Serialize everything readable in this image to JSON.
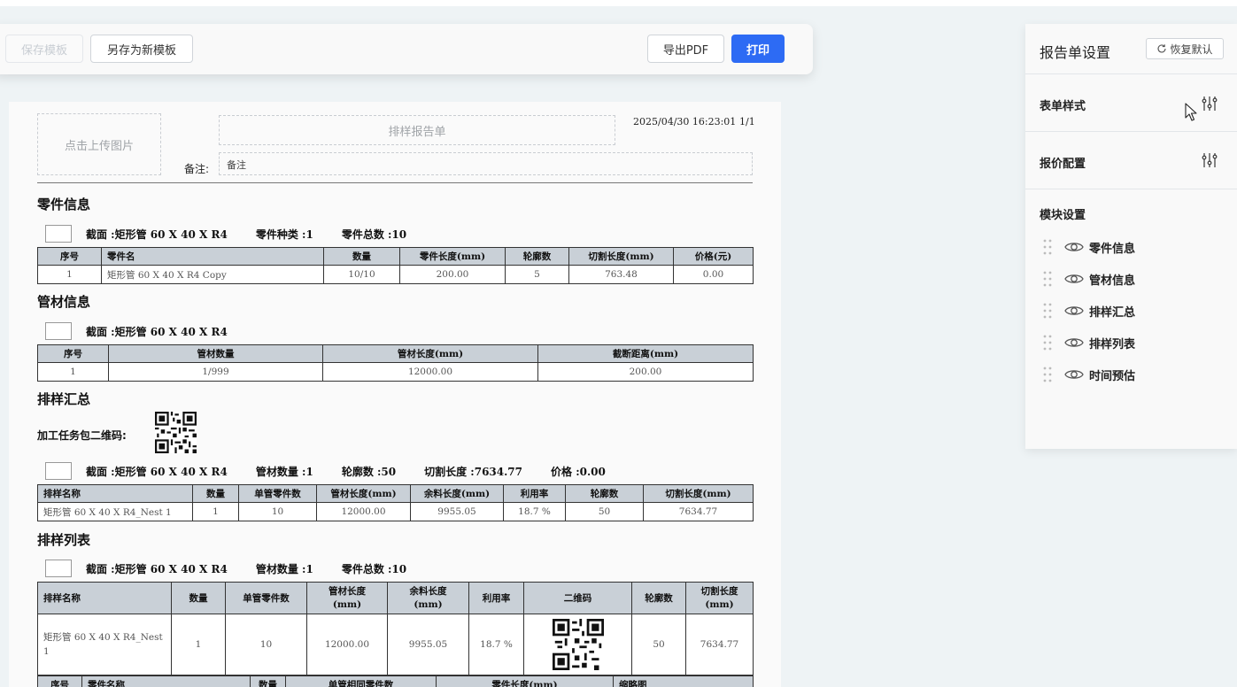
{
  "toolbar": {
    "save_template": "保存模板",
    "save_as_new": "另存为新模板",
    "export_pdf": "导出PDF",
    "print": "打印"
  },
  "header": {
    "upload_placeholder": "点击上传图片",
    "title_placeholder": "排样报告单",
    "datetime": "2025/04/30 16:23:01",
    "page": "1/1",
    "remark_label": "备注:",
    "remark_value": "备注"
  },
  "parts": {
    "title": "零件信息",
    "meta": [
      "截面 :矩形管 60 X 40 X R4",
      "零件种类 :1",
      "零件总数 :10"
    ],
    "columns": [
      "序号",
      "零件名",
      "数量",
      "零件长度(mm)",
      "轮廓数",
      "切割长度(mm)",
      "价格(元)"
    ],
    "rows": [
      [
        "1",
        "矩形管 60 X 40 X R4 Copy",
        "10/10",
        "200.00",
        "5",
        "763.48",
        "0.00"
      ]
    ]
  },
  "pipes": {
    "title": "管材信息",
    "meta": [
      "截面 :矩形管 60 X 40 X R4"
    ],
    "columns": [
      "序号",
      "管材数量",
      "管材长度(mm)",
      "截断距离(mm)"
    ],
    "rows": [
      [
        "1",
        "1/999",
        "12000.00",
        "200.00"
      ]
    ]
  },
  "summary": {
    "title": "排样汇总",
    "qr_label": "加工任务包二维码:",
    "meta": [
      "截面 :矩形管 60 X 40 X R4",
      "管材数量 :1",
      "轮廓数 :50",
      "切割长度 :7634.77",
      "价格 :0.00"
    ],
    "columns": [
      "排样名称",
      "数量",
      "单管零件数",
      "管材长度(mm)",
      "余料长度(mm)",
      "利用率",
      "轮廓数",
      "切割长度(mm)"
    ],
    "rows": [
      [
        "矩形管 60 X 40 X R4_Nest 1",
        "1",
        "10",
        "12000.00",
        "9955.05",
        "18.7 %",
        "50",
        "7634.77"
      ]
    ]
  },
  "nest_list": {
    "title": "排样列表",
    "meta": [
      "截面 :矩形管 60 X 40 X R4",
      "管材数量 :1",
      "零件总数 :10"
    ],
    "columns": [
      "排样名称",
      "数量",
      "单管零件数",
      "管材长度\n(mm)",
      "余料长度\n(mm)",
      "利用率",
      "二维码",
      "轮廓数",
      "切割长度\n(mm)"
    ],
    "row": [
      "矩形管 60 X 40 X R4_Nest 1",
      "1",
      "10",
      "12000.00",
      "9955.05",
      "18.7 %",
      "",
      "50",
      "7634.77"
    ],
    "sub_columns": [
      "序号",
      "零件名称",
      "数量",
      "单管相同零件数",
      "零件长度(mm)",
      "缩略图"
    ]
  },
  "panel": {
    "title": "报告单设置",
    "reset": "恢复默认",
    "form_style": "表单样式",
    "quote_config": "报价配置",
    "module_settings": "模块设置",
    "modules": [
      "零件信息",
      "管材信息",
      "排样汇总",
      "排样列表",
      "时间预估"
    ]
  },
  "colors": {
    "primary": "#2d6bf4",
    "table_header": "#c9d0d7"
  }
}
